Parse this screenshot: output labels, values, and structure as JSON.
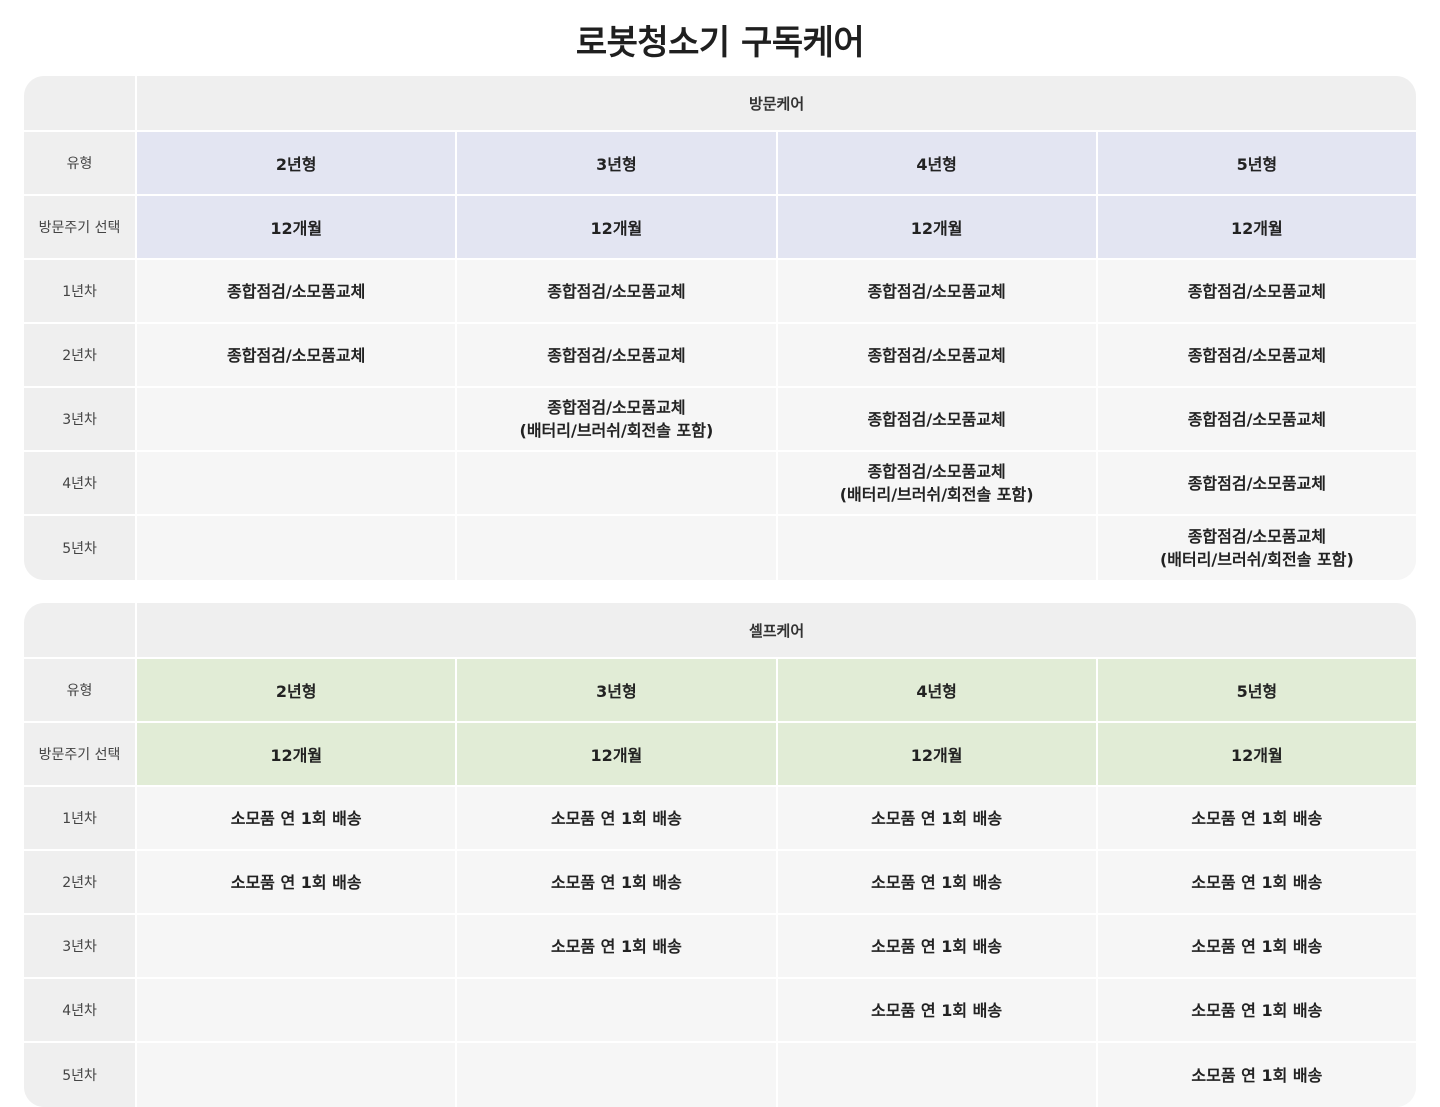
{
  "title": "로봇청소기 구독케어",
  "visit_care": {
    "section_label": "방문케어",
    "type_label": "유형",
    "period_label": "방문주기 선택",
    "types": [
      "2년형",
      "3년형",
      "4년형",
      "5년형"
    ],
    "periods": [
      "12개월",
      "12개월",
      "12개월",
      "12개월"
    ],
    "years": [
      {
        "label": "1년차",
        "cells": [
          [
            "종합점검/소모품교체"
          ],
          [
            "종합점검/소모품교체"
          ],
          [
            "종합점검/소모품교체"
          ],
          [
            "종합점검/소모품교체"
          ]
        ]
      },
      {
        "label": "2년차",
        "cells": [
          [
            "종합점검/소모품교체"
          ],
          [
            "종합점검/소모품교체"
          ],
          [
            "종합점검/소모품교체"
          ],
          [
            "종합점검/소모품교체"
          ]
        ]
      },
      {
        "label": "3년차",
        "cells": [
          [],
          [
            "종합점검/소모품교체",
            "(배터리/브러쉬/회전솔 포함)"
          ],
          [
            "종합점검/소모품교체"
          ],
          [
            "종합점검/소모품교체"
          ]
        ]
      },
      {
        "label": "4년차",
        "cells": [
          [],
          [],
          [
            "종합점검/소모품교체",
            "(배터리/브러쉬/회전솔 포함)"
          ],
          [
            "종합점검/소모품교체"
          ]
        ]
      },
      {
        "label": "5년차",
        "cells": [
          [],
          [],
          [],
          [
            "종합점검/소모품교체",
            "(배터리/브러쉬/회전솔 포함)"
          ]
        ]
      }
    ]
  },
  "self_care": {
    "section_label": "셀프케어",
    "type_label": "유형",
    "period_label": "방문주기 선택",
    "types": [
      "2년형",
      "3년형",
      "4년형",
      "5년형"
    ],
    "periods": [
      "12개월",
      "12개월",
      "12개월",
      "12개월"
    ],
    "years": [
      {
        "label": "1년차",
        "cells": [
          [
            "소모품 연 1회 배송"
          ],
          [
            "소모품 연 1회 배송"
          ],
          [
            "소모품 연 1회 배송"
          ],
          [
            "소모품 연 1회 배송"
          ]
        ]
      },
      {
        "label": "2년차",
        "cells": [
          [
            "소모품 연 1회 배송"
          ],
          [
            "소모품 연 1회 배송"
          ],
          [
            "소모품 연 1회 배송"
          ],
          [
            "소모품 연 1회 배송"
          ]
        ]
      },
      {
        "label": "3년차",
        "cells": [
          [],
          [
            "소모품 연 1회 배송"
          ],
          [
            "소모품 연 1회 배송"
          ],
          [
            "소모품 연 1회 배송"
          ]
        ]
      },
      {
        "label": "4년차",
        "cells": [
          [],
          [],
          [
            "소모품 연 1회 배송"
          ],
          [
            "소모품 연 1회 배송"
          ]
        ]
      },
      {
        "label": "5년차",
        "cells": [
          [],
          [],
          [],
          [
            "소모품 연 1회 배송"
          ]
        ]
      }
    ]
  },
  "colors": {
    "visit_highlight": "#e3e5f2",
    "self_highlight": "#e1ecd6",
    "label_bg": "#efefef",
    "cell_bg": "#f6f6f6"
  }
}
